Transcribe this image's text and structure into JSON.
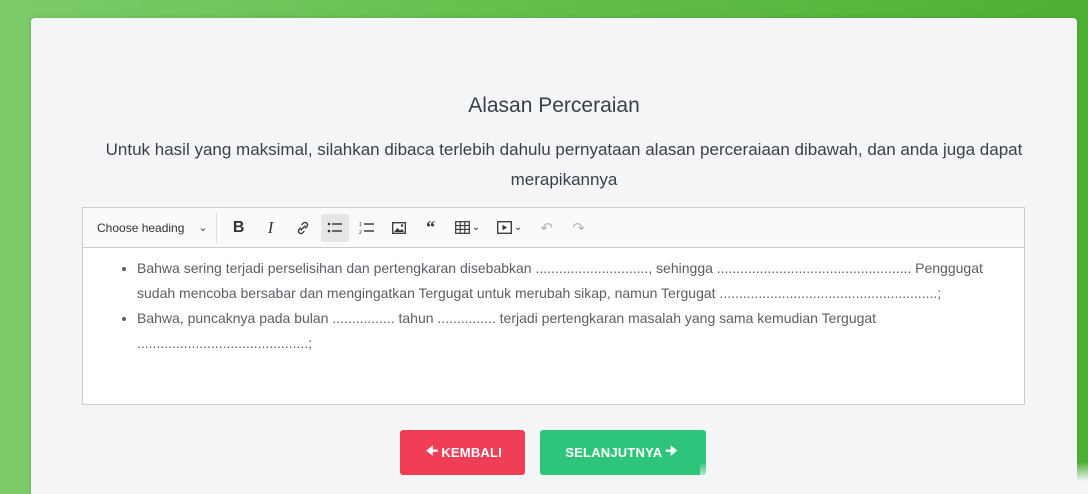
{
  "page": {
    "title": "Alasan Perceraian",
    "subtitle": "Untuk hasil yang maksimal, silahkan dibaca terlebih dahulu pernyataan alasan perceraiaan dibawah, dan anda juga dapat merapikannya"
  },
  "toolbar": {
    "heading_select": "Choose heading",
    "icons": [
      "bold-icon",
      "italic-icon",
      "link-icon",
      "bulleted-list-icon",
      "numbered-list-icon",
      "image-icon",
      "blockquote-icon",
      "table-icon",
      "media-icon",
      "undo-icon",
      "redo-icon"
    ]
  },
  "editor": {
    "items": [
      "Bahwa sering terjadi perselisihan dan pertengkaran disebabkan ............................., sehingga .................................................. Penggugat sudah mencoba bersabar dan mengingatkan Tergugat untuk merubah sikap, namun Tergugat ........................................................;",
      "Bahwa, puncaknya pada bulan ................ tahun ............... terjadi pertengkaran masalah yang sama kemudian Tergugat ............................................;"
    ]
  },
  "buttons": {
    "back_label": "KEMBALI",
    "next_label": "SELANJUTNYA"
  },
  "colors": {
    "back_button": "#ef3e56",
    "next_button": "#2ec47a",
    "background": "#6cc553"
  }
}
